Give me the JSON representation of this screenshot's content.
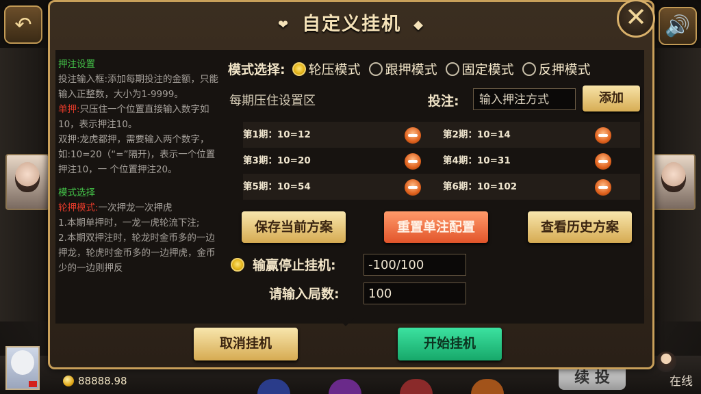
{
  "dialog": {
    "title": "自定义挂机",
    "close_symbol": "✕"
  },
  "background": {
    "coins": "88888.98",
    "continue_label": "续 投",
    "online_label": "在线"
  },
  "info": {
    "section1_title": "押注设置",
    "line1": "投注输入框:添加每期投注的金额，只能输入正整数，大小为1-9999。",
    "single_prefix": "单押:",
    "single_text": "只压住一个位置直接输入数字如10，表示押注10。",
    "double_text": "双押:龙虎都押，需要输入两个数字，如:10=20（“=”隔开)，表示一个位置押注10，一  个位置押注20。",
    "section2_title": "模式选择",
    "rotate_prefix": "轮押模式:",
    "rotate_text": "一次押龙一次押虎",
    "rule1": "1.本期单押时，一龙一虎轮流下注;",
    "rule2": "2.本期双押注时，轮龙时金币多的一边押龙，轮虎时金币多的一边押虎，金币少的一边则押反"
  },
  "mode": {
    "label": "模式选择:",
    "options": [
      {
        "label": "轮压模式",
        "selected": true
      },
      {
        "label": "跟押模式",
        "selected": false
      },
      {
        "label": "固定模式",
        "selected": false
      },
      {
        "label": "反押模式",
        "selected": false
      }
    ]
  },
  "zone_label": "每期压住设置区",
  "bet": {
    "label": "投注:",
    "placeholder": "输入押注方式",
    "add_label": "添加"
  },
  "periods": [
    {
      "left": "第1期：10=12",
      "right": "第2期：10=14"
    },
    {
      "left": "第3期：10=20",
      "right": "第4期：10=31"
    },
    {
      "left": "第5期：10=54",
      "right": "第6期：10=102"
    }
  ],
  "actions": {
    "save_label": "保存当前方案",
    "reset_label": "重置单注配置",
    "history_label": "查看历史方案"
  },
  "stop": {
    "label": "输赢停止挂机:",
    "value": "-100/100",
    "enabled": true
  },
  "rounds": {
    "label": "请输入局数:",
    "value": "100"
  },
  "footer": {
    "cancel_label": "取消挂机",
    "start_label": "开始挂机"
  },
  "colors": {
    "accent_gold": "#d7ad54",
    "reset_orange": "#e2552b",
    "start_green": "#17a86a",
    "info_heading_green": "#45c84a",
    "info_red": "#e23a2a"
  }
}
